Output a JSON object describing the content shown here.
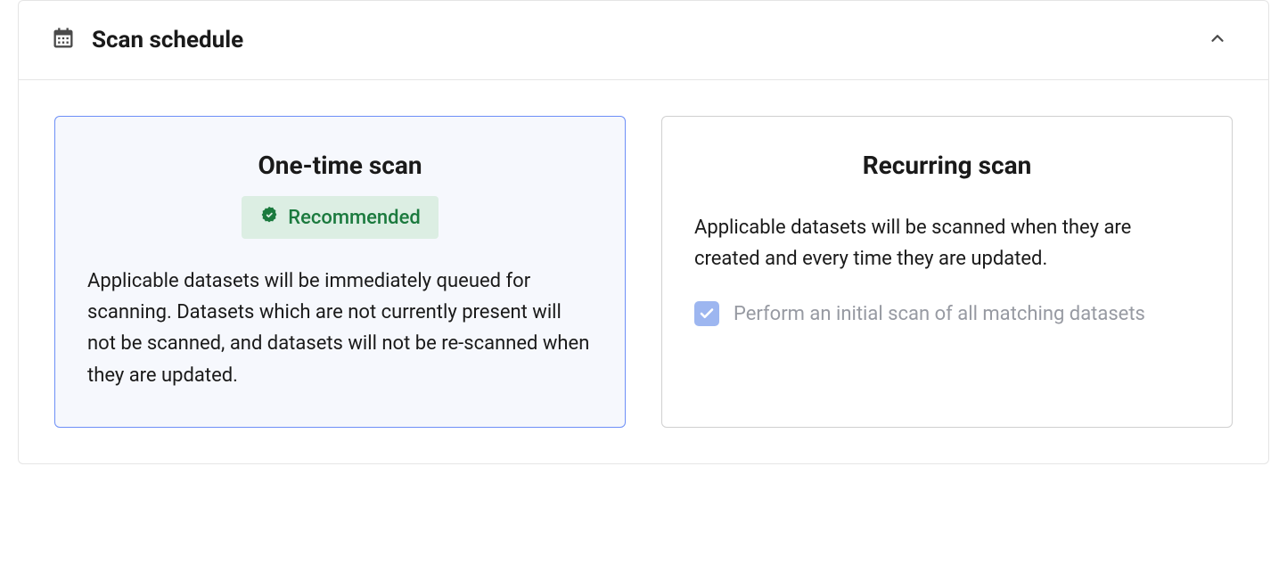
{
  "section": {
    "title": "Scan schedule"
  },
  "options": {
    "onetime": {
      "title": "One-time scan",
      "badge_label": "Recommended",
      "description": "Applicable datasets will be immediately queued for scanning. Datasets which are not currently present will not be scanned, and datasets will not be re-scanned when they are updated.",
      "selected": true
    },
    "recurring": {
      "title": "Recurring scan",
      "description": "Applicable datasets will be scanned when they are created and every time they are updated.",
      "checkbox_label": "Perform an initial scan of all matching datasets",
      "checkbox_checked": true
    }
  }
}
